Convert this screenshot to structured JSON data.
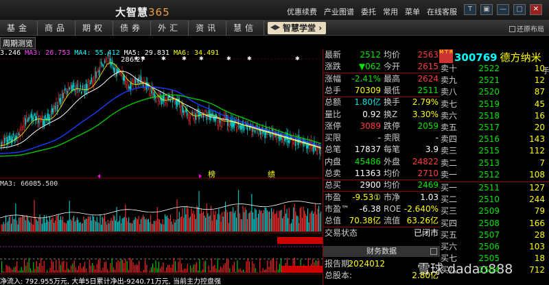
{
  "app": {
    "title": "大智慧",
    "version": "365",
    "menu": [
      "优惠续费",
      "产业图谱",
      "委托",
      "常用",
      "菜单",
      "在线客服"
    ],
    "window_buttons": [
      "T",
      "▣",
      "—",
      "□",
      "✕"
    ]
  },
  "nav": {
    "tabs": [
      "基金",
      "商品",
      "期权",
      "债券",
      "外汇",
      "资讯",
      "慧信"
    ],
    "academy": "智慧学堂",
    "restore": "还原布局"
  },
  "chart": {
    "period_tab": "周期测览",
    "legend_prefix": "3.246",
    "ma3": "MA3: 26.753",
    "ma4": "MA4: 55.412",
    "ma5": "MA5: 29.831",
    "ma6": "MA6: 34.491",
    "peak_label": "286.27",
    "tags": [
      "榜",
      "绩"
    ],
    "volume_legend": "MA3: 66085.500",
    "flow_text": "净流入: 792.955万元, 大单5日累计净出-9240.71万元, 当前主力控盘强",
    "colors": {
      "ma3": "#ff44ff",
      "ma4": "#00ffff",
      "ma5": "#ffffff",
      "ma6": "#ffff00",
      "ma_long": "#00c800",
      "ma_mid": "#1a3cff"
    }
  },
  "quote": {
    "rows": [
      {
        "l1": "最新",
        "v1": "2512",
        "c1": "green",
        "l2": "均价",
        "v2": "2563",
        "c2": "red"
      },
      {
        "l1": "涨跌",
        "v1": "▼062",
        "c1": "green",
        "l2": "今开",
        "v2": "2615",
        "c2": "red"
      },
      {
        "l1": "涨幅",
        "v1": "-2.41%",
        "c1": "green",
        "l2": "最高",
        "v2": "2624",
        "c2": "red"
      },
      {
        "l1": "总手",
        "v1": "70309",
        "c1": "yellow",
        "l2": "最低",
        "v2": "2511",
        "c2": "green"
      },
      {
        "l1": "总额",
        "v1": "1.80亿",
        "c1": "cyan",
        "l2": "换手",
        "v2": "2.79%",
        "c2": "yellow"
      },
      {
        "l1": "量比",
        "v1": "0.92",
        "c1": "white",
        "l2": "换Z",
        "v2": "3.30%",
        "c2": "yellow"
      },
      {
        "l1": "涨停",
        "v1": "3089",
        "c1": "red",
        "l2": "跌停",
        "v2": "2059",
        "c2": "green"
      },
      {
        "l1": "买限",
        "v1": "-",
        "c1": "white",
        "l2": "卖限",
        "v2": "-",
        "c2": "white"
      },
      {
        "l1": "总笔",
        "v1": "17837",
        "c1": "white",
        "l2": "每笔",
        "v2": "3.9",
        "c2": "white"
      },
      {
        "l1": "内盘",
        "v1": "45486",
        "c1": "green",
        "l2": "外盘",
        "v2": "24822",
        "c2": "red"
      },
      {
        "l1": "总卖",
        "v1": "11363",
        "c1": "white",
        "l2": "均价",
        "v2": "2710",
        "c2": "red"
      },
      {
        "l1": "总买",
        "v1": "2900",
        "c1": "white",
        "l2": "均价",
        "v2": "2469",
        "c2": "green"
      },
      {
        "l1": "市盈",
        "v1": "-9.53①",
        "c1": "yellow",
        "l2": "市净",
        "v2": "1.03",
        "c2": "white"
      },
      {
        "l1": "市盈™",
        "v1": "-6.38",
        "c1": "white",
        "l2": "ROE",
        "v2": "-2.640%",
        "c2": "yellow"
      },
      {
        "l1": "总值",
        "v1": "70.38亿",
        "c1": "yellow",
        "l2": "流值",
        "v2": "63.26亿",
        "c2": "yellow"
      },
      {
        "l1": "交易状态",
        "v1": "",
        "c1": "white",
        "l2": "",
        "v2": "已闭市",
        "c2": "white"
      }
    ],
    "fin_tab": "财务数据",
    "report_label": "报告期:",
    "report_value": "2024012",
    "eps_label": "总股本:",
    "eps_value": "2.80亿"
  },
  "book": {
    "mtr": "M T R",
    "code": "300769",
    "name": "德方纳米",
    "hand_label": "手",
    "asks": [
      {
        "label": "卖十",
        "price": "2522",
        "vol": "10"
      },
      {
        "label": "卖九",
        "price": "2521",
        "vol": "12"
      },
      {
        "label": "卖八",
        "price": "2520",
        "vol": "87"
      },
      {
        "label": "卖七",
        "price": "2519",
        "vol": "45"
      },
      {
        "label": "卖六",
        "price": "2518",
        "vol": "16"
      },
      {
        "label": "卖五",
        "price": "2517",
        "vol": "20"
      },
      {
        "label": "卖四",
        "price": "2516",
        "vol": "143"
      },
      {
        "label": "卖三",
        "price": "2515",
        "vol": "112"
      },
      {
        "label": "卖二",
        "price": "2513",
        "vol": "7"
      },
      {
        "label": "卖一",
        "price": "2512",
        "vol": "108"
      }
    ],
    "bids": [
      {
        "label": "买一",
        "price": "2511",
        "vol": "127"
      },
      {
        "label": "买二",
        "price": "2510",
        "vol": "244"
      },
      {
        "label": "买三",
        "price": "2509",
        "vol": "79"
      },
      {
        "label": "买四",
        "price": "2508",
        "vol": "166"
      },
      {
        "label": "买五",
        "price": "2507",
        "vol": "28"
      },
      {
        "label": "买六",
        "price": "2506",
        "vol": "103"
      },
      {
        "label": "买七",
        "price": "2505",
        "vol": "18"
      },
      {
        "label": "买八",
        "price": "2504",
        "vol": "712"
      }
    ]
  },
  "watermark": "雪球 dadao888"
}
